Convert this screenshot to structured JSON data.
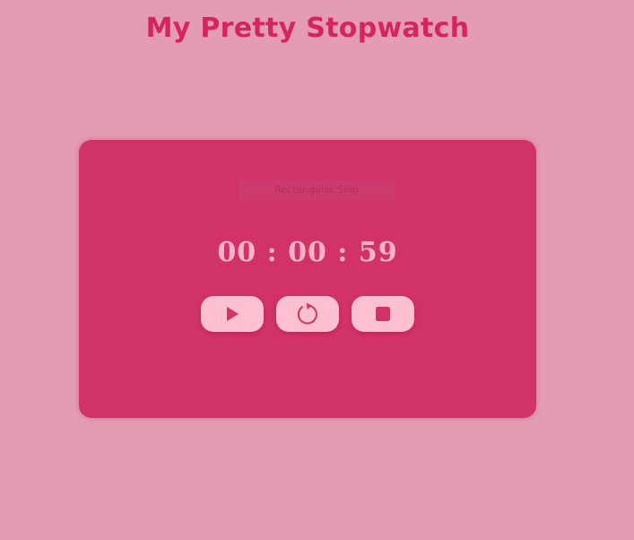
{
  "page": {
    "title": "My Pretty Stopwatch"
  },
  "stopwatch": {
    "overlay_label": "Rectangular Snip",
    "time_display": "00 : 00 : 59",
    "buttons": [
      {
        "name": "start",
        "icon": "play-icon"
      },
      {
        "name": "reset",
        "icon": "reset-icon"
      },
      {
        "name": "stop",
        "icon": "stop-icon"
      }
    ]
  },
  "colors": {
    "background": "#e49cb3",
    "title": "#d6245f",
    "card": "#d13268",
    "time_text": "#fbb3c8",
    "button_bg": "#fdc0d1",
    "icon": "#d13268"
  }
}
